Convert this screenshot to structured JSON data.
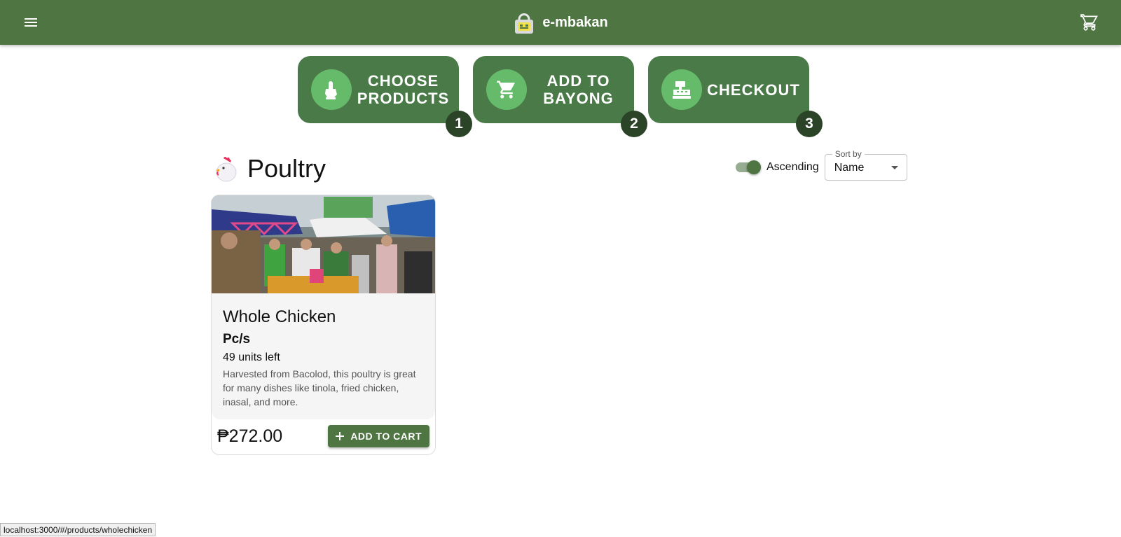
{
  "app": {
    "title": "e-mbakan",
    "logo_icon": "basket-logo-icon",
    "accent": "#4f7543"
  },
  "appbar": {
    "menu_icon": "menu-icon",
    "cart_icon": "cart-icon"
  },
  "steps": [
    {
      "label": "CHOOSE PRODUCTS",
      "number": "1",
      "icon": "hand-pointer-icon"
    },
    {
      "label": "ADD TO BAYONG",
      "number": "2",
      "icon": "cart-icon"
    },
    {
      "label": "CHECKOUT",
      "number": "3",
      "icon": "cash-register-icon"
    }
  ],
  "category": {
    "title": "Poultry",
    "icon": "chicken-icon"
  },
  "sort": {
    "toggle_label": "Ascending",
    "toggle_on": true,
    "select_legend": "Sort by",
    "select_value": "Name"
  },
  "products": [
    {
      "name": "Whole Chicken",
      "unit": "Pc/s",
      "stock": "49 units left",
      "description": "Harvested from Bacolod, this poultry is great for many dishes like tinola, fried chicken, inasal, and more.",
      "price": "₱272.00",
      "button_label": "ADD TO CART",
      "image": "market-photo"
    }
  ],
  "status_bar": {
    "url": "localhost:3000/#/products/wholechicken"
  }
}
